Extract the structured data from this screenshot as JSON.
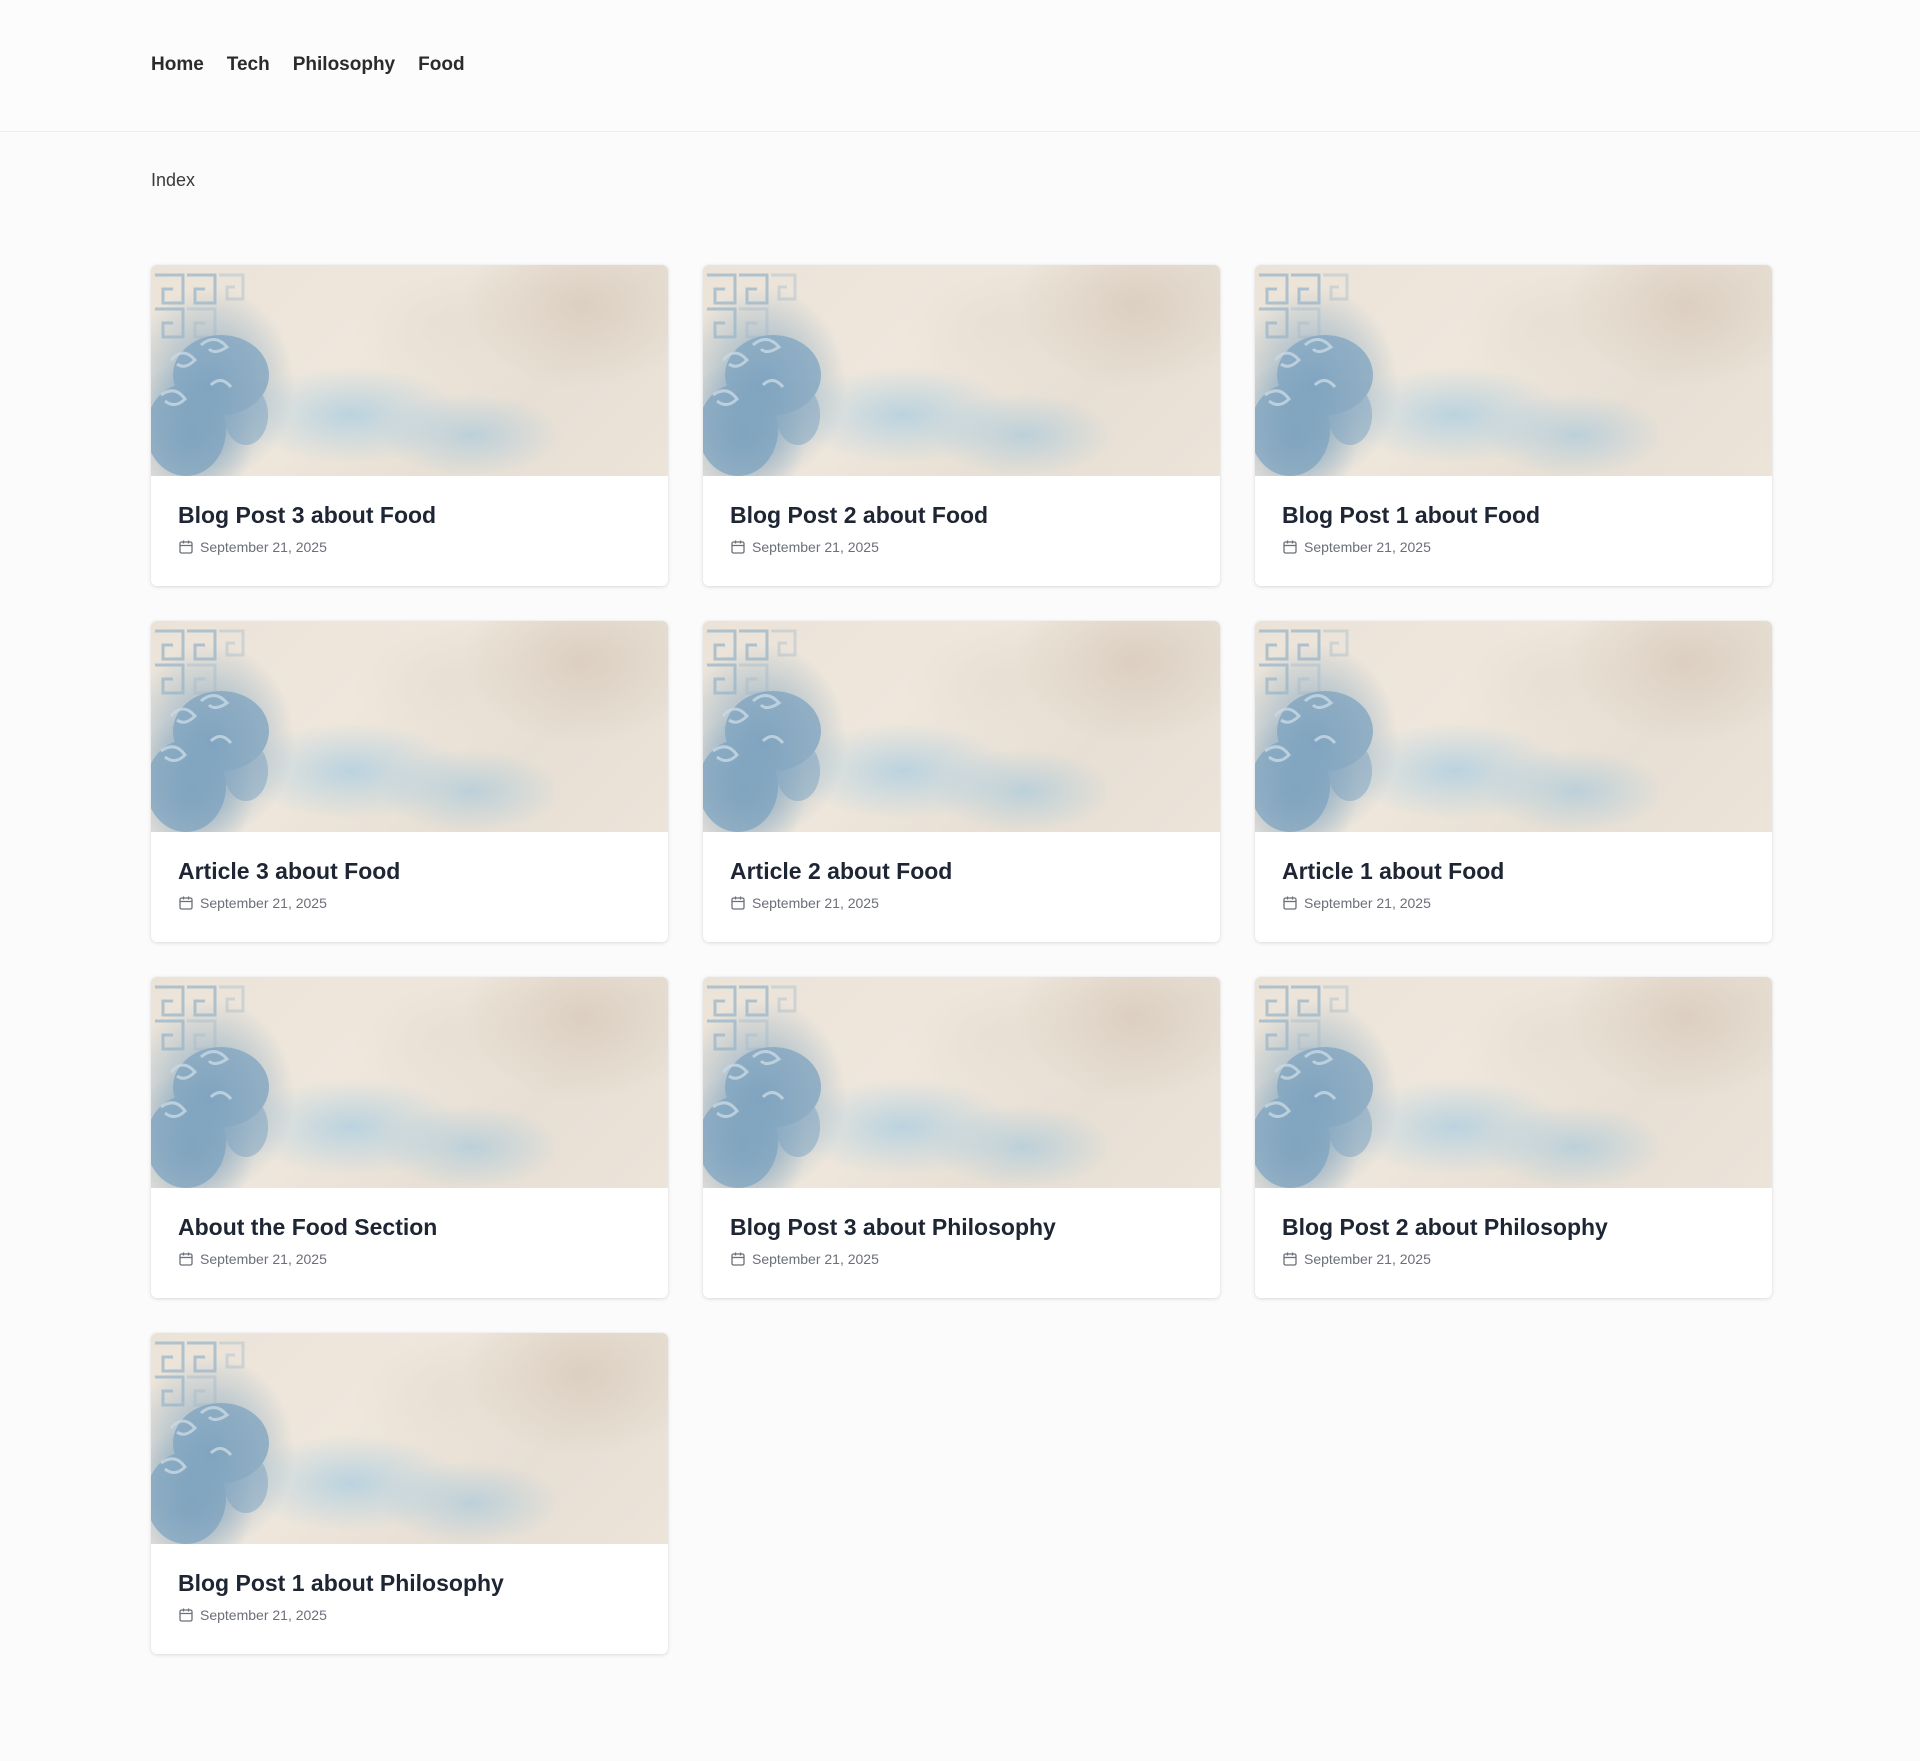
{
  "nav": {
    "items": [
      {
        "label": "Home"
      },
      {
        "label": "Tech"
      },
      {
        "label": "Philosophy"
      },
      {
        "label": "Food"
      }
    ]
  },
  "breadcrumb": "Index",
  "icons": {
    "date": "calendar-icon",
    "image": "watercolor-guardian-lion-illustration"
  },
  "colors": {
    "title": "#1e2533",
    "meta": "#6b6f78",
    "image_blue": "#8fb5cf",
    "image_cream": "#ebe3d8"
  },
  "posts": [
    {
      "title": "Blog Post 3 about Food",
      "date": "September 21, 2025"
    },
    {
      "title": "Blog Post 2 about Food",
      "date": "September 21, 2025"
    },
    {
      "title": "Blog Post 1 about Food",
      "date": "September 21, 2025"
    },
    {
      "title": "Article 3 about Food",
      "date": "September 21, 2025"
    },
    {
      "title": "Article 2 about Food",
      "date": "September 21, 2025"
    },
    {
      "title": "Article 1 about Food",
      "date": "September 21, 2025"
    },
    {
      "title": "About the Food Section",
      "date": "September 21, 2025"
    },
    {
      "title": "Blog Post 3 about Philosophy",
      "date": "September 21, 2025"
    },
    {
      "title": "Blog Post 2 about Philosophy",
      "date": "September 21, 2025"
    },
    {
      "title": "Blog Post 1 about Philosophy",
      "date": "September 21, 2025"
    }
  ]
}
